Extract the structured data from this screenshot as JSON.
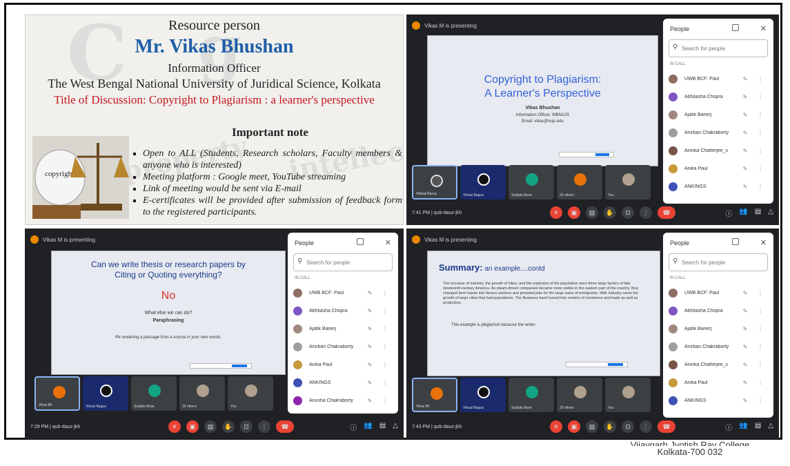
{
  "poster": {
    "resource_label": "Resource person",
    "name": "Mr. Vikas Bhushan",
    "role": "Information Officer",
    "institution": "The West Bengal National University of Juridical Science, Kolkata",
    "discussion_title": "Title of Discussion: Copyright to Plagiarism : a learner's perspective",
    "note_heading": "Important note",
    "bullets": [
      "Open to ALL (Students, Research scholars, Faculty members & anyone who is interested)",
      "Meeting platform : Google meet, YouTube streaming",
      "Link of meeting would be sent via E-mail",
      "E-certificates will be provided after submission of feedback form to the registered participants."
    ],
    "image_caption": "copyright"
  },
  "meet_common": {
    "presenting": "Vikas M is presenting",
    "people_title": "People",
    "search_placeholder": "Search for people",
    "in_call": "IN CALL",
    "participants": [
      "UWB BCF: Paul",
      "Abhilasha Chopra",
      "Ajatik Banerj",
      "Anirban Chakraborty",
      "Anirika Chatterjee_s",
      "Anika Paul",
      "ANKINGS"
    ]
  },
  "q2": {
    "slide_title_1": "Copyright to Plagiarism:",
    "slide_title_2": "A Learner's Perspective",
    "slide_name": "Vikas Bhushan",
    "slide_role": "Information Officer, WBNUJS",
    "slide_email": "Email: vikas@nujs.edu",
    "tiles": [
      "Shibaji Barua",
      "Virtual Bagua",
      "Sudipta Bose",
      "29 others",
      "You"
    ],
    "clock": "7:41 PM | qub-dauz-jkh"
  },
  "q3": {
    "slide_title_1": "Can we write thesis or research papers by",
    "slide_title_2": "Citing or Quoting everything?",
    "slide_no": "No",
    "slide_q": "What else we can do?",
    "slide_para": "Paraphrasing",
    "slide_def": "Re rendering a passage from a source in your own words.",
    "extra_participant": "Anusha Chakraborty",
    "tiles": [
      "Vikas Bh",
      "Virtual Bagua",
      "Sudipta Bose",
      "29 others",
      "You"
    ],
    "clock": "7:29 PM | qub-dauz-jkh"
  },
  "q4": {
    "slide_title_bold": "Summary:",
    "slide_title_rest": " an example....contd",
    "slide_body": "The increase of industry, the growth of cities, and the explosion of the population were three large factors of late nineteenth-century America. As steam-driven companies became more visible in the eastern part of the country, they changed farm hands into factory workers and provided jobs for the large wave of immigrants. With industry came the growth of large cities that had populations. The Business hand turned into centers of commerce and trade as well as production.",
    "slide_note": "This example is plagiarism because the writer:",
    "tiles": [
      "Vikas Bh",
      "Virtual Bagua",
      "Sudipta Bose",
      "29 others",
      "You"
    ],
    "clock": "7:43 PM | qub-dauz-jkh"
  },
  "footer": {
    "line1": "Vijaygarh Jyotish Ray College",
    "line2": "Kolkata-700 032"
  },
  "colors": {
    "meet_bg": "#202124",
    "accent_blue": "#1f5fa8",
    "accent_red": "#c4161c",
    "end_call": "#ea4335",
    "presenting_dot": "#ea8600"
  }
}
